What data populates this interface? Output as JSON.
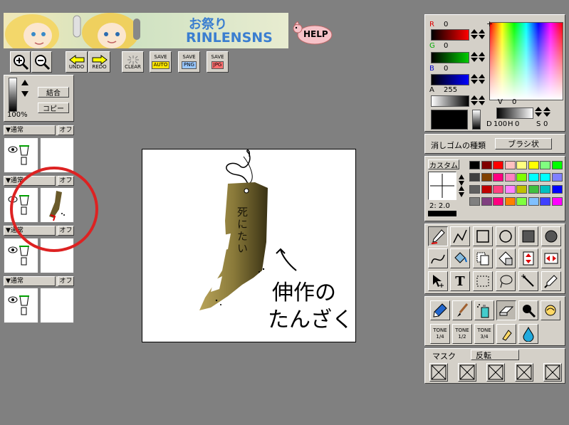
{
  "banner": {
    "title_jp": "お祭り",
    "title_en": "RINLENSNS",
    "help_label": "HELP"
  },
  "toolbar": {
    "undo_label": "UNDO",
    "redo_label": "REDO",
    "clear_label": "CLEAR",
    "save_auto_top": "SAVE",
    "save_auto_bottom": "AUTO",
    "save_png_top": "SAVE",
    "save_png_bottom": "PNG",
    "save_jpg_top": "SAVE",
    "save_jpg_bottom": "JPG"
  },
  "layers_panel": {
    "merge_label": "結合",
    "copy_label": "コピー",
    "opacity_label": "100%",
    "opacity_value": 1.0,
    "layers": [
      {
        "mode": "▼通常",
        "off": "オフ"
      },
      {
        "mode": "▼通常",
        "off": "オフ"
      },
      {
        "mode": "▼通常",
        "off": "オフ"
      },
      {
        "mode": "▼通常",
        "off": "オフ"
      }
    ]
  },
  "canvas": {
    "handwriting_line1": "伸作の",
    "handwriting_line2": "たんざく",
    "tag_text": "死にたい"
  },
  "color_panel": {
    "r_label": "R",
    "r_value": "0",
    "g_label": "G",
    "g_value": "0",
    "b_label": "B",
    "b_value": "0",
    "a_label": "A",
    "a_value": "255",
    "v_label": "V",
    "v_value": "0",
    "d_label": "D",
    "d_value": "100",
    "h_label": "H",
    "h_value": "0",
    "s_label": "S",
    "s_value": "0"
  },
  "eraser": {
    "label": "消しゴムの種類",
    "value": "ブラシ状"
  },
  "brush": {
    "custom_label": "カスタム",
    "size_label": "2: 2.0"
  },
  "palette": {
    "colors": [
      "#000000",
      "#800000",
      "#ff0000",
      "#ffc0c0",
      "#ffff80",
      "#ffff00",
      "#80ff80",
      "#00ff00",
      "#404040",
      "#804000",
      "#ff0080",
      "#ff80c0",
      "#80ff00",
      "#00ffff",
      "#00ffff",
      "#8080ff",
      "#606060",
      "#c00000",
      "#ff4080",
      "#ff80ff",
      "#c0c000",
      "#40c040",
      "#00c0c0",
      "#0000ff",
      "#808080",
      "#804080",
      "#ff0080",
      "#ff8000",
      "#80ff40",
      "#80c0ff",
      "#4040ff",
      "#ff00ff"
    ],
    "accent_red": "#cc2222"
  },
  "tools": {
    "tone_labels": [
      "TONE",
      "TONE",
      "TONE"
    ],
    "tone_fracs": [
      "1/4",
      "1/2",
      "3/4"
    ]
  },
  "mask": {
    "label": "マスク",
    "invert_label": "反転"
  }
}
